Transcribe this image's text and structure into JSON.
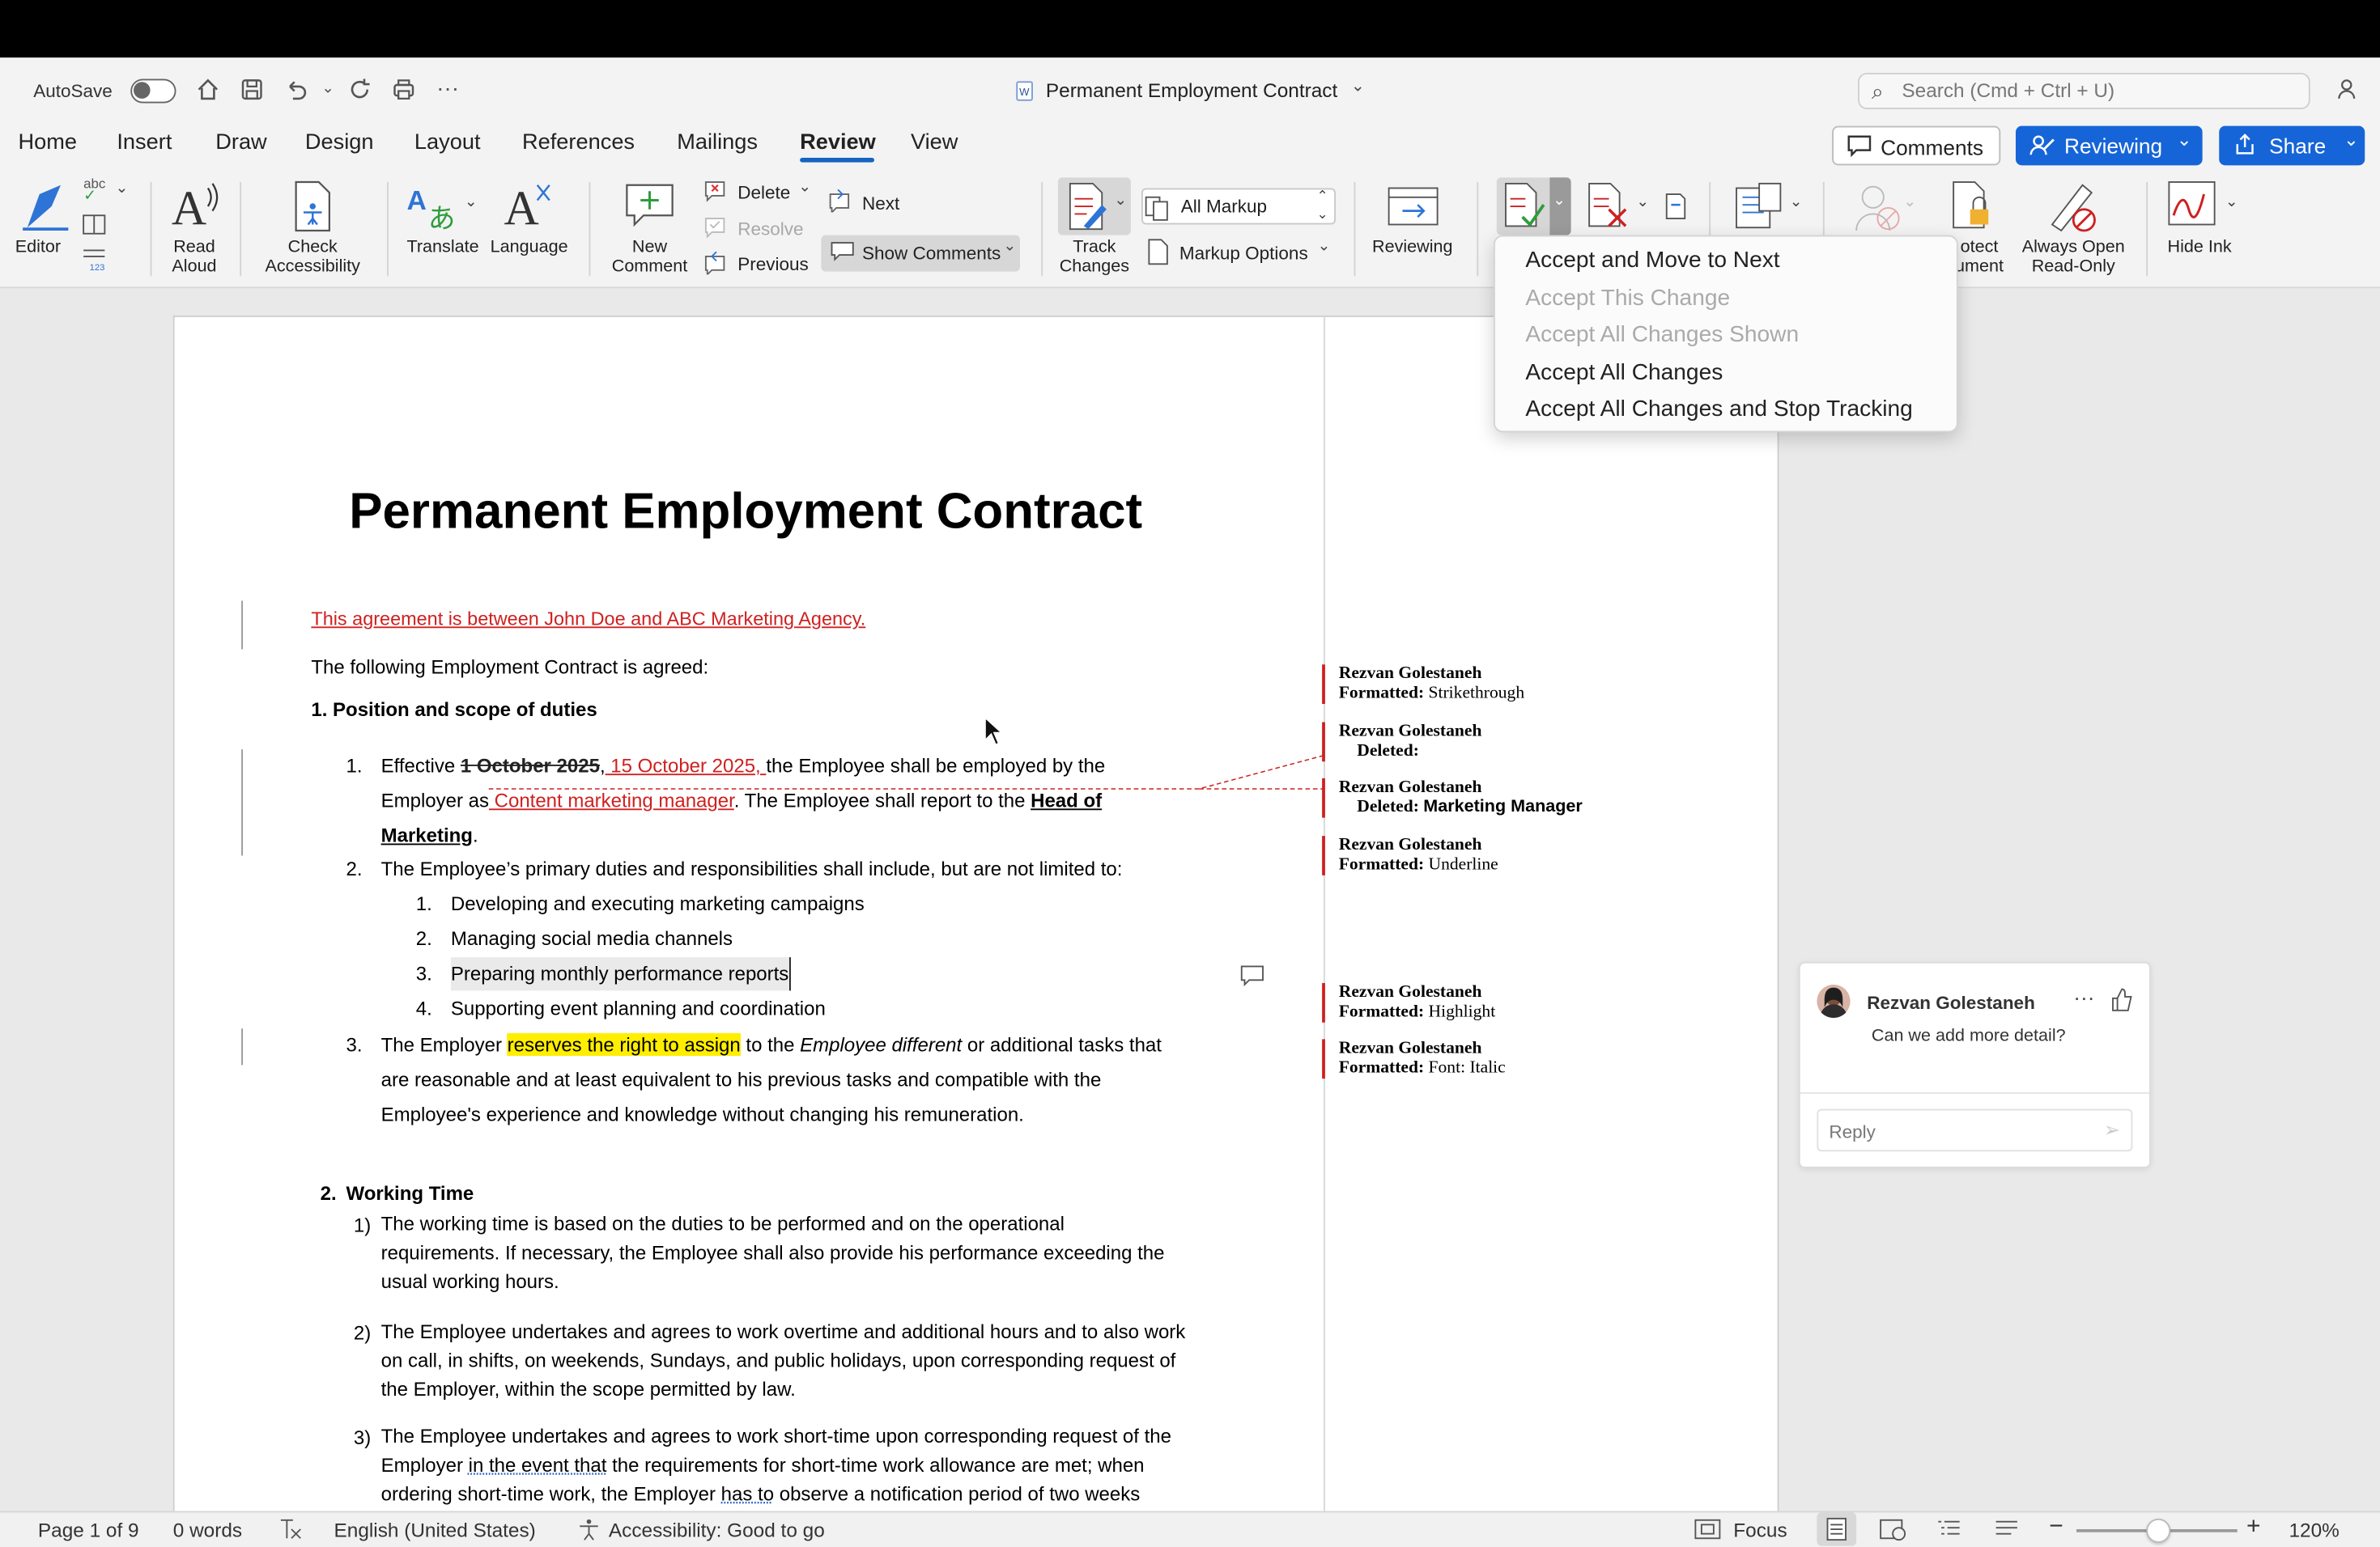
{
  "window": {
    "title": "Permanent Employment Contract",
    "autosave_label": "AutoSave",
    "search_placeholder": "Search (Cmd + Ctrl + U)"
  },
  "tabs": [
    "Home",
    "Insert",
    "Draw",
    "Design",
    "Layout",
    "References",
    "Mailings",
    "Review",
    "View"
  ],
  "header_buttons": {
    "comments": "Comments",
    "reviewing": "Reviewing",
    "share": "Share"
  },
  "ribbon": {
    "editor": "Editor",
    "read_aloud_1": "Read",
    "read_aloud_2": "Aloud",
    "check_acc_1": "Check",
    "check_acc_2": "Accessibility",
    "translate": "Translate",
    "language": "Language",
    "new_comment_1": "New",
    "new_comment_2": "Comment",
    "delete": "Delete",
    "resolve": "Resolve",
    "previous": "Previous",
    "next": "Next",
    "show_comments": "Show Comments",
    "track_1": "Track",
    "track_2": "Changes",
    "all_markup": "All Markup",
    "markup_options": "Markup Options",
    "reviewing": "Reviewing",
    "protect_1": "otect",
    "protect_2": "ument",
    "always_open_1": "Always Open",
    "always_open_2": "Read-Only",
    "hide_ink": "Hide Ink",
    "abc": "abc",
    "n123": "123"
  },
  "accept_menu": [
    "Accept and Move to Next",
    "Accept This Change",
    "Accept All Changes Shown",
    "Accept All Changes",
    "Accept All Changes and Stop Tracking"
  ],
  "document": {
    "title": "Permanent Employment Contract",
    "intro_inserted": "This agreement is between John Doe and ABC Marketing Agency.",
    "intro": "The following Employment Contract is agreed:",
    "h1": "1. Position and scope of duties",
    "i1_num": "1.",
    "i1_a": "Effective ",
    "i1_del": "1 October 2025",
    ",": ",",
    "i1_ins": " 15 October 2025, ",
    "i1_b": "the Employee shall be employed by the",
    "i1_c": "Employer as",
    "i1_ins2": " Content marketing manager",
    "i1_d": ". The Employee shall report to the ",
    "i1_bold1": "Head of",
    "i1_bold2": "Marketing",
    "period": ".",
    "i2_num": "2.",
    "i2": "The Employee’s primary duties and responsibilities shall include, but are not limited to:",
    "sub": [
      {
        "n": "1.",
        "t": "Developing and executing marketing campaigns"
      },
      {
        "n": "2.",
        "t": "Managing social media channels"
      },
      {
        "n": "3.",
        "t": "Preparing monthly performance reports"
      },
      {
        "n": "4.",
        "t": "Supporting event planning and coordination"
      }
    ],
    "i3_num": "3.",
    "i3_a": "The Employer ",
    "i3_hl": "reserves the right to assign",
    "i3_b": " to the ",
    "i3_it": "Employee different",
    "i3_c": " or additional tasks that",
    "i3_l2": "are reasonable and at least equivalent to his previous tasks and compatible with the",
    "i3_l3": "Employee's experience and knowledge without changing his remuneration.",
    "h2_num": "2.",
    "h2": "Working Time",
    "w1_num": "1)",
    "w1_l1": "The working time is based on the duties to be performed and on the operational",
    "w1_l2": "requirements. If necessary, the Employee shall also provide his performance exceeding the",
    "w1_l3": "usual working hours.",
    "w2_num": "2)",
    "w2_l1": "The Employee undertakes and agrees to work overtime and additional hours and to also work",
    "w2_l2": "on call, in shifts, on weekends, Sundays, and public holidays, upon corresponding request of",
    "w2_l3": "the Employer, within the scope permitted by law.",
    "w3_num": "3)",
    "w3_l1": "The Employee undertakes and agrees to work short-time upon corresponding request of the",
    "w3_l2a": "Employer ",
    "w3_l2u": "in the event that",
    "w3_l2b": " the requirements for short-time work allowance are met; when",
    "w3_l3a": "ordering short-time work, the Employer ",
    "w3_l3u": "has to",
    "w3_l3b": " observe a notification period of two weeks"
  },
  "balloons": [
    {
      "author": "Rezvan Golestaneh",
      "label": "Formatted:",
      "detail": "Strikethrough"
    },
    {
      "author": "Rezvan Golestaneh",
      "label": "Deleted:",
      "detail": ""
    },
    {
      "author": "Rezvan Golestaneh",
      "label": "Deleted:",
      "detail": "Marketing Manager"
    },
    {
      "author": "Rezvan Golestaneh",
      "label": "Formatted:",
      "detail": "Underline"
    },
    {
      "author": "Rezvan Golestaneh",
      "label": "Formatted:",
      "detail": "Highlight"
    },
    {
      "author": "Rezvan Golestaneh",
      "label": "Formatted:",
      "detail": "Font: Italic"
    }
  ],
  "comment": {
    "author": "Rezvan Golestaneh",
    "text": "Can we add more detail?",
    "reply_placeholder": "Reply"
  },
  "status": {
    "page": "Page 1 of 9",
    "words": "0 words",
    "language": "English (United States)",
    "accessibility": "Accessibility: Good to go",
    "focus": "Focus",
    "zoom": "120%"
  }
}
